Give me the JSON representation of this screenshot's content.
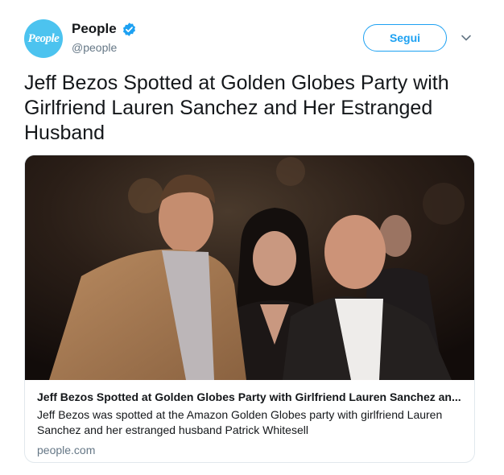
{
  "tweet": {
    "author": {
      "avatar_text": "People",
      "display_name": "People",
      "handle": "@people",
      "verified": true
    },
    "follow_label": "Segui",
    "text": "Jeff Bezos Spotted at Golden Globes Party with Girlfriend Lauren Sanchez and Her Estranged Husband"
  },
  "card": {
    "title": "Jeff Bezos Spotted at Golden Globes Party with Girlfriend Lauren Sanchez an...",
    "description": "Jeff Bezos was spotted at the Amazon Golden Globes party with girlfriend Lauren Sanchez and her estranged husband Patrick Whitesell",
    "domain": "people.com"
  },
  "colors": {
    "brand_blue": "#1da1f2",
    "avatar_bg": "#4cc3ef",
    "secondary_text": "#657786",
    "border": "#e1e8ed"
  },
  "icons": {
    "verified": "verified-badge-icon",
    "menu": "chevron-down-icon"
  }
}
